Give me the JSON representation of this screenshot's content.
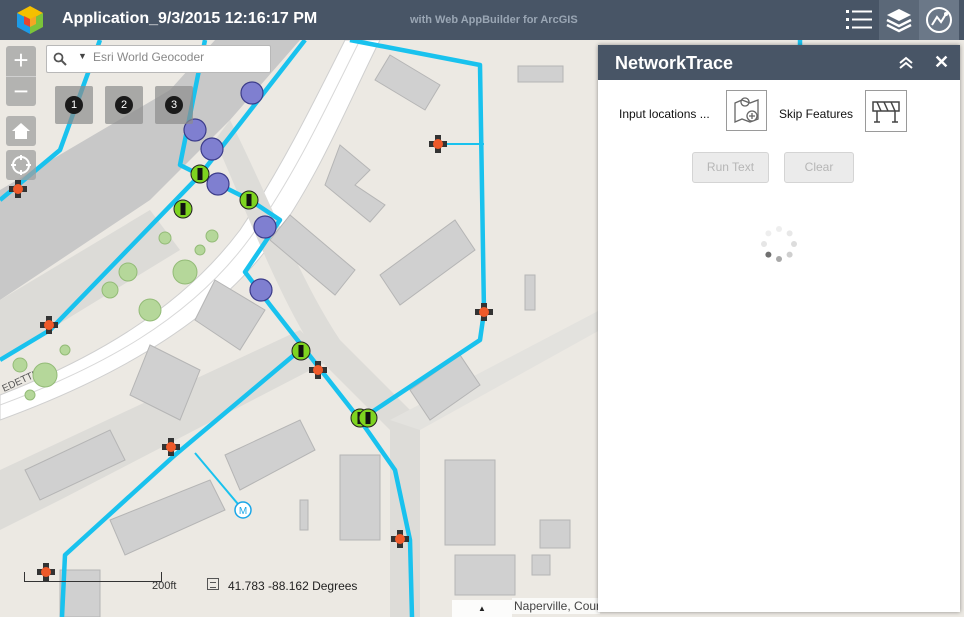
{
  "header": {
    "title": "Application_9/3/2015 12:16:17 PM",
    "subtitle": "with Web AppBuilder for ArcGIS",
    "buttons": [
      {
        "name": "list-icon"
      },
      {
        "name": "layers-icon"
      },
      {
        "name": "network-trace-icon"
      }
    ]
  },
  "map": {
    "zoom_in": "+",
    "zoom_out": "−",
    "search": {
      "placeholder": "Esri World Geocoder"
    },
    "bookmarks": [
      "1",
      "2",
      "3"
    ],
    "street_label": "EDETTI DR",
    "meter_label": "M",
    "scale_label": "200ft",
    "coordinates": "41.783 -88.162 Degrees",
    "attribution_toggle": "▲",
    "attribution": "Naperville, County"
  },
  "panel": {
    "title": "NetworkTrace",
    "input_locations_label": "Input locations ...",
    "skip_features_label": "Skip Features",
    "run_button": "Run Text",
    "clear_button": "Clear"
  },
  "colors": {
    "header_bg": "#485566",
    "network_line": "#19c2ee",
    "valve_fill": "#7f7fd0",
    "junction_fill": "#7ed320",
    "hydrant_fill": "#ef5a2a"
  }
}
